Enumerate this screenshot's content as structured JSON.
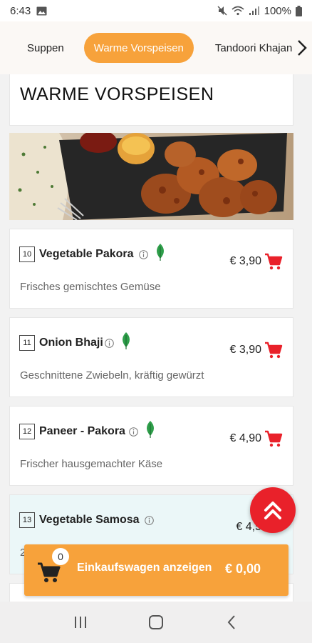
{
  "status": {
    "time": "6:43",
    "battery": "100%"
  },
  "categories": [
    {
      "label": "Suppen"
    },
    {
      "label": "Warme Vorspeisen"
    },
    {
      "label": "Tandoori Khajan"
    }
  ],
  "section_title": "WARME VORSPEISEN",
  "dishes": [
    {
      "number": "10",
      "name": "Vegetable Pakora",
      "price": "€ 3,90",
      "description": "Frisches gemischtes Gemüse",
      "vegetarian": true
    },
    {
      "number": "11",
      "name": "Onion Bhaji",
      "price": "€ 3,90",
      "description": "Geschnittene Zwiebeln, kräftig gewürzt",
      "vegetarian": true
    },
    {
      "number": "12",
      "name": "Paneer - Pakora",
      "price": "€ 4,90",
      "description": "Frischer hausgemachter Käse",
      "vegetarian": true
    },
    {
      "number": "13",
      "name": "Vegetable Samosa",
      "price": "€ 4,5",
      "description": "2",
      "vegetarian": false
    }
  ],
  "cart": {
    "count": "0",
    "label": "Einkaufswagen anzeigen",
    "total": "€ 0,00"
  },
  "colors": {
    "accent": "#f7a23b",
    "cart_red": "#e9212a",
    "leaf_green": "#2e9e4a"
  },
  "icons": [
    "gallery-icon",
    "mute-icon",
    "wifi-icon",
    "signal-icon",
    "battery-icon",
    "chevron-right-icon",
    "info-icon",
    "leaf-icon",
    "cart-icon",
    "double-chevron-up-icon",
    "recents-icon",
    "home-icon",
    "back-icon"
  ]
}
